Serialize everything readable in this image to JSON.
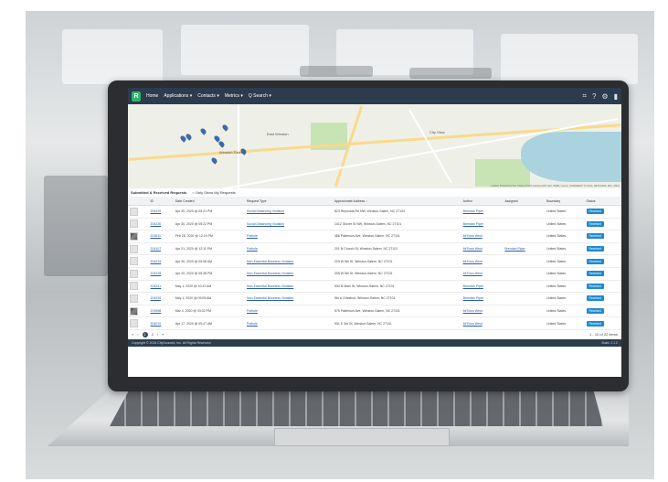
{
  "nav": {
    "logo_letter": "R",
    "items": [
      "Home",
      "Applications ▾",
      "Contacts ▾",
      "Metrics ▾",
      "Q Search ▾"
    ],
    "icons": [
      "tag-icon",
      "help-icon",
      "gear-icon",
      "user-icon"
    ]
  },
  "map": {
    "labels": [
      "East Winston",
      "Winston-Salem",
      "City View"
    ],
    "attribution": "Leaflet | Powered by Esri | State of North Carolina DOT, Esri, HERE, Garmin, INCREMENT P, USGS, METI/NASA, EPA, USDA"
  },
  "list": {
    "title": "Submitted & Received Requests",
    "only_mine_label": "Only Show My Requests",
    "columns": [
      "",
      "ID",
      "Date Created",
      "Request Type",
      "Approximate Address ↓",
      "Author",
      "Assigned",
      "Boundary",
      "Status"
    ],
    "rows": [
      {
        "photo": false,
        "id": "204229",
        "date": "Apr 30, 2020 @ 05:21 PM",
        "type": "Social Distancing Violation",
        "address": "823 Reynolda Rd NW, Winston-Salem, NC 27104",
        "author": "Brendan Piper",
        "assigned": "",
        "boundary": "United States",
        "status": "Received"
      },
      {
        "photo": false,
        "id": "204230",
        "date": "Apr 30, 2020 @ 05:22 PM",
        "type": "Social Distancing Violation",
        "address": "1412 Glover St NW, Winston-Salem, NC 27101",
        "author": "Brendan Piper",
        "assigned": "",
        "boundary": "United States",
        "status": "Received"
      },
      {
        "photo": true,
        "id": "203911",
        "date": "Feb 28, 2020 @ 12:19 PM",
        "type": "Pothole",
        "address": "486 Patterson Ave, Winston-Salem, NC 27101",
        "author": "MrTown West",
        "assigned": "",
        "boundary": "United States",
        "status": "Received"
      },
      {
        "photo": false,
        "id": "204107",
        "date": "Apr 21, 2020 @ 12:11 PM",
        "type": "Pothole",
        "address": "201 N Church St, Winston-Salem, NC 27101",
        "author": "MrTown West",
        "assigned": "Brendan Piper",
        "boundary": "United States",
        "status": "Received"
      },
      {
        "photo": false,
        "id": "204219",
        "date": "Apr 30, 2020 @ 05:08 AM",
        "type": "Non-Essential Business Violation",
        "address": "229 W 5th St, Winston-Salem, NC 27101",
        "author": "MrTown West",
        "assigned": "",
        "boundary": "United States",
        "status": "Received"
      },
      {
        "photo": false,
        "id": "204228",
        "date": "Apr 30, 2020 @ 05:38 PM",
        "type": "Non-Essential Business Violation",
        "address": "305 W 5th St, Winston-Salem, NC 27101",
        "author": "MrTown West",
        "assigned": "",
        "boundary": "United States",
        "status": "Received"
      },
      {
        "photo": false,
        "id": "204241",
        "date": "May 1, 2020 @ 10:22 AM",
        "type": "Non-Essential Business Violation",
        "address": "534 N Main St, Winston-Salem, NC 27101",
        "author": "Brendan Piper",
        "assigned": "",
        "boundary": "United States",
        "status": "Received"
      },
      {
        "photo": false,
        "id": "204239",
        "date": "May 1, 2020 @ 09:05 AM",
        "type": "Non-Essential Business Violation",
        "address": "5th & Chestnut, Winston-Salem, NC 27101",
        "author": "Brendan Piper",
        "assigned": "",
        "boundary": "United States",
        "status": "Received"
      },
      {
        "photo": true,
        "id": "203958",
        "date": "Mar 4, 2020 @ 03:32 PM",
        "type": "Pothole",
        "address": "575 Patterson Ave, Winston-Salem, NC 27101",
        "author": "MrTown West",
        "assigned": "",
        "boundary": "United States",
        "status": "Received"
      },
      {
        "photo": false,
        "id": "204070",
        "date": "Apr 17, 2020 @ 09:47 AM",
        "type": "Pothole",
        "address": "501 E 3rd St, Winston-Salem, NC 27101",
        "author": "MrTown West",
        "assigned": "",
        "boundary": "United States",
        "status": "Received"
      }
    ]
  },
  "pager": {
    "prev_first": "«",
    "prev": "‹",
    "current": "1",
    "next_page": "2",
    "next": "›",
    "last": "»",
    "summary": "1 - 10 of 22 items"
  },
  "footer": {
    "copyright": "Copyright © 2016 CitySourced, Inc. All Rights Reserved.",
    "build": "Build: 2.1.2"
  }
}
